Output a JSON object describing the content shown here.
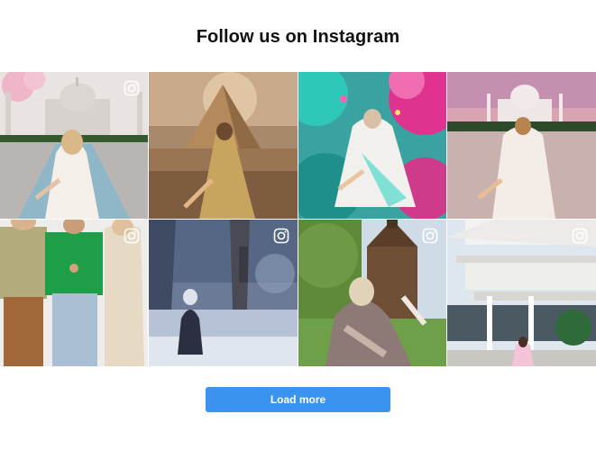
{
  "heading": "Follow us on Instagram",
  "load_more_label": "Load more",
  "accent_color": "#3b93f0",
  "posts": [
    {
      "icon": "instagram-icon",
      "scene": "taj-mahal-white-dress"
    },
    {
      "icon": "instagram-icon",
      "scene": "pyramid-gold-dress"
    },
    {
      "icon": "instagram-icon",
      "scene": "holi-color-festival"
    },
    {
      "icon": "instagram-icon",
      "scene": "taj-mahal-sunset"
    },
    {
      "icon": "instagram-icon",
      "scene": "three-models-green-tshirt"
    },
    {
      "icon": "instagram-icon",
      "scene": "winter-forest"
    },
    {
      "icon": "instagram-icon",
      "scene": "wooden-church"
    },
    {
      "icon": "instagram-icon",
      "scene": "white-modern-building"
    }
  ]
}
